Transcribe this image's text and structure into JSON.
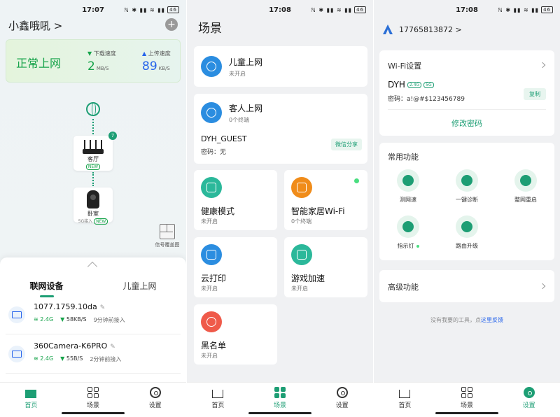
{
  "screen1": {
    "time": "17:07",
    "title": "小鑫哦吼 >",
    "net_status": "正常上网",
    "download_label": "下载速度",
    "download_value": "2",
    "download_unit": "MB/S",
    "upload_label": "上传速度",
    "upload_value": "89",
    "upload_unit": "KB/S",
    "router_name": "客厅",
    "router_badge": "NEW",
    "router_count": "7",
    "satellite_name": "卧室",
    "satellite_sub": "5G接入",
    "satellite_badge": "NEW",
    "coverage_label": "信号覆盖图",
    "tabs": [
      "联网设备",
      "儿童上网"
    ],
    "devices": [
      {
        "name": "1077.1759.10da",
        "band": "2.4G",
        "speed": "58KB/S",
        "time": "9分钟前接入"
      },
      {
        "name": "360Camera-K6PRO",
        "band": "2.4G",
        "speed": "55B/S",
        "time": "2分钟前接入"
      }
    ]
  },
  "screen2": {
    "time": "17:08",
    "title": "场景",
    "kids": {
      "title": "儿童上网",
      "sub": "未开启"
    },
    "guest": {
      "title": "客人上网",
      "sub": "0个终端",
      "ssid": "DYH_GUEST",
      "pwd": "密码：无",
      "share": "微信分享"
    },
    "health": {
      "title": "健康模式",
      "sub": "未开启"
    },
    "smart": {
      "title": "智能家居Wi-Fi",
      "sub": "0个终端"
    },
    "print": {
      "title": "云打印",
      "sub": "未开启"
    },
    "game": {
      "title": "游戏加速",
      "sub": "未开启"
    },
    "black": {
      "title": "黑名单",
      "sub": "未开启"
    }
  },
  "screen3": {
    "time": "17:08",
    "phone": "17765813872 >",
    "wifi_settings": "Wi-Fi设置",
    "ssid": "DYH",
    "band1": "2.4G",
    "band2": "5G",
    "password": "密码：a!@#$123456789",
    "copy": "复制",
    "change_pwd": "修改密码",
    "common": "常用功能",
    "funcs": [
      "测网速",
      "一键诊断",
      "整网重启",
      "指示灯",
      "路由升级"
    ],
    "advanced": "高级功能",
    "feedback_pre": "没有我要的工具，点",
    "feedback_link": "这里反馈"
  },
  "nav": [
    "首页",
    "场景",
    "设置"
  ]
}
